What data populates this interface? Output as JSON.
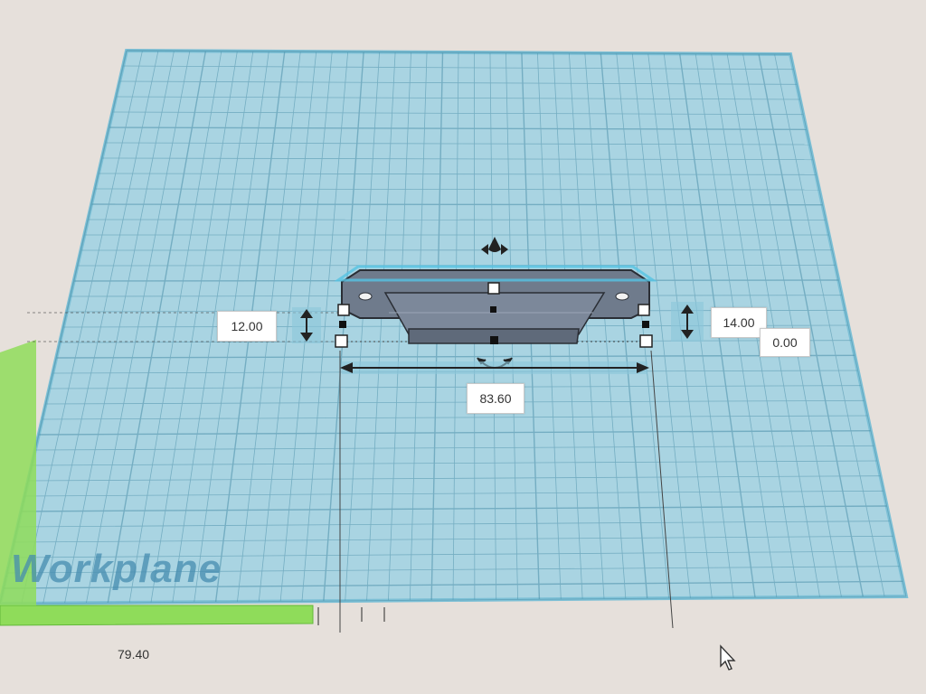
{
  "workplane": {
    "label": "Workplane"
  },
  "dimensions": {
    "left_height": "12.00",
    "right_height": "14.00",
    "elevation": "0.00",
    "width": "83.60"
  },
  "ruler": {
    "value": "79.40"
  },
  "icons": {
    "lift": "lift-arrow-icon",
    "rotate": "rotate-arrow-icon",
    "cursor": "mouse-cursor-icon"
  },
  "colors": {
    "grid_fill": "#a9d4e2",
    "grid_line": "#4a8fa8",
    "shape_fill": "#6f7b8c",
    "ruler_green": "#8fdc5a",
    "background": "#e6e0db"
  }
}
